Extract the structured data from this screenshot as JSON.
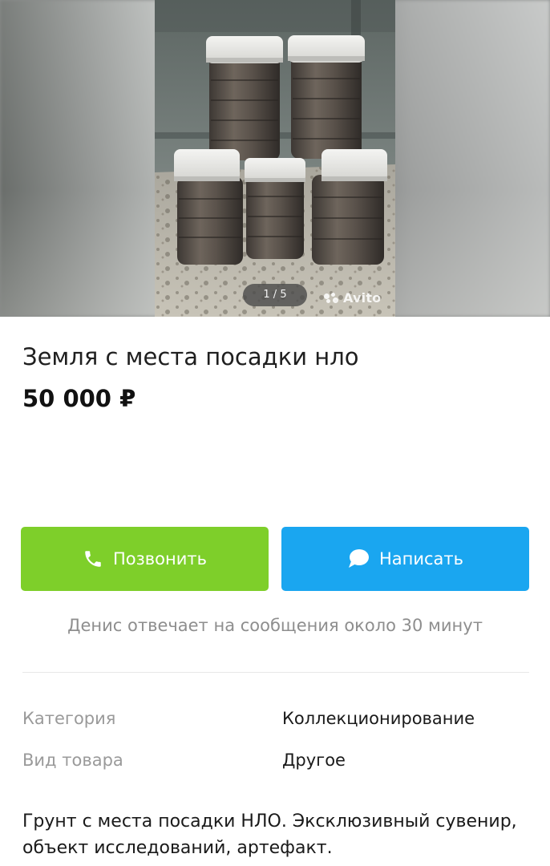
{
  "gallery": {
    "counter": "1 / 5",
    "watermark": "Avito"
  },
  "listing": {
    "title": "Земля с места посадки нло",
    "price": "50 000 ₽"
  },
  "actions": {
    "call_label": "Позвонить",
    "call_icon": "phone-icon",
    "write_label": "Написать",
    "write_icon": "chat-bubble-icon",
    "call_color": "#7ecf2a",
    "write_color": "#1aa6f0"
  },
  "seller": {
    "reply_note": "Денис отвечает на сообщения около 30 минут"
  },
  "params": [
    {
      "label": "Категория",
      "value": "Коллекционирование"
    },
    {
      "label": "Вид товара",
      "value": "Другое"
    }
  ],
  "description": "Грунт с места посадки НЛО. Эксклюзивный сувенир, объект исследований, артефакт."
}
